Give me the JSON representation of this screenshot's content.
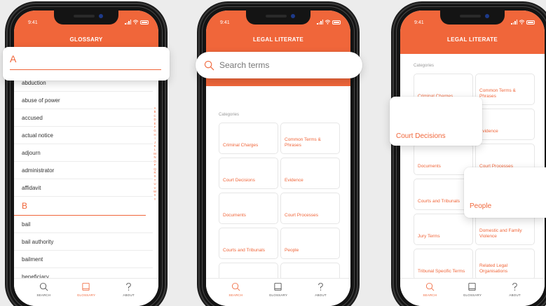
{
  "status": {
    "time": "9:41"
  },
  "phones": {
    "glossary": {
      "title": "GLOSSARY",
      "overlay_letter": "A",
      "items": [
        "abduction",
        "abuse of power",
        "accused",
        "actual notice",
        "adjourn",
        "administrator",
        "affidavit"
      ],
      "letter_b": "B",
      "items_b": [
        "bail",
        "bail authority",
        "bailment",
        "beneficiary"
      ],
      "alphabet": [
        "A",
        "B",
        "C",
        "D",
        "E",
        "F",
        "G",
        "H",
        "I",
        "J",
        "K",
        "L",
        "M",
        "N",
        "O",
        "P",
        "Q",
        "R",
        "S",
        "T",
        "U",
        "V",
        "W",
        "X",
        "Y"
      ]
    },
    "search": {
      "title": "LEGAL LITERATE",
      "search_placeholder": "Search terms",
      "categories_label": "Categories",
      "tiles": [
        "Criminal Charges",
        "Common Terms & Phrases",
        "Court Decisions",
        "Evidence",
        "Documents",
        "Court Processes",
        "Courts and Tribunals",
        "People",
        "",
        ""
      ]
    },
    "categories": {
      "title": "LEGAL LITERATE",
      "categories_label": "Categories",
      "tiles": [
        "Criminal Charges",
        "Common Terms & Phrases",
        "",
        "Evidence",
        "Documents",
        "Court Processes",
        "Courts and Tribunals",
        "",
        "Jury Terms",
        "Domestic and Family Violence",
        "Tribunal Specific Terms",
        "Related Legal Organisations"
      ],
      "float_court": "Court Decisions",
      "float_people": "People"
    }
  },
  "tabs": [
    {
      "label": "SEARCH",
      "icon": "search-icon"
    },
    {
      "label": "GLOSSARY",
      "icon": "book-icon"
    },
    {
      "label": "ABOUT",
      "icon": "question-icon"
    }
  ],
  "colors": {
    "accent": "#f0663a",
    "background": "#ececec"
  }
}
